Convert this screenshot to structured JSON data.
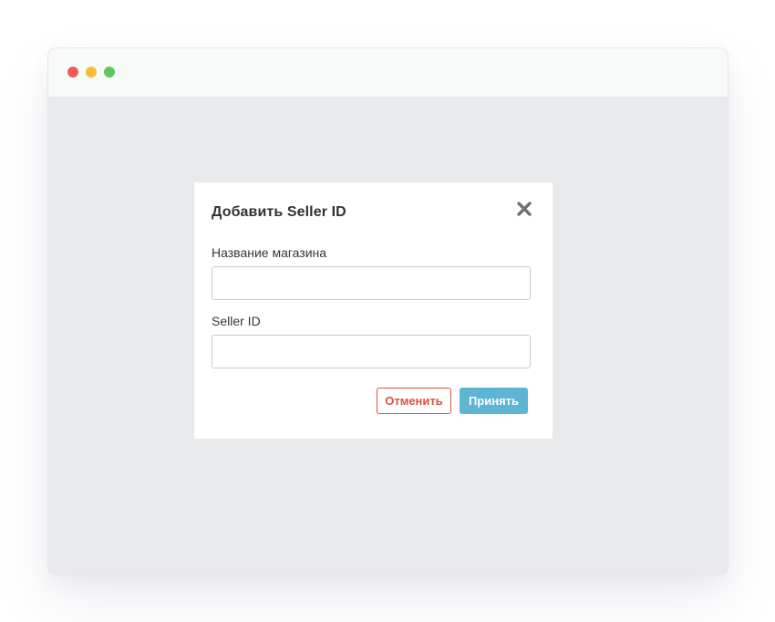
{
  "window": {
    "traffic_lights": {
      "close_color": "#f05b56",
      "minimize_color": "#f8bd32",
      "maximize_color": "#5fc65a"
    }
  },
  "dialog": {
    "title": "Добавить Seller ID",
    "close_icon": "close-icon",
    "fields": [
      {
        "label": "Название магазина",
        "value": "",
        "placeholder": ""
      },
      {
        "label": "Seller ID",
        "value": "",
        "placeholder": ""
      }
    ],
    "cancel_label": "Отменить",
    "accept_label": "Принять",
    "colors": {
      "cancel": "#d9553c",
      "accept": "#5db4d3"
    }
  }
}
